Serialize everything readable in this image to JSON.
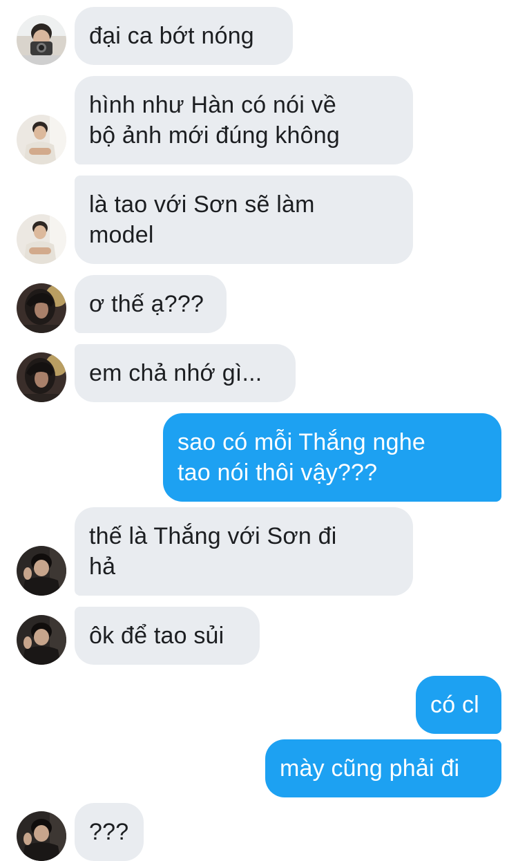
{
  "colors": {
    "incoming_bubble": "#e9ecf0",
    "outgoing_bubble": "#1da1f2",
    "incoming_text": "#1c1e21",
    "outgoing_text": "#ffffff"
  },
  "messages": [
    {
      "direction": "incoming",
      "sender_avatar": "avatar-camera-user",
      "lines": [
        "đại ca bớt nóng"
      ]
    },
    {
      "direction": "incoming",
      "sender_avatar": "avatar-arms-crossed-user",
      "lines": [
        "hình như Hàn có nói về",
        "bộ ảnh mới đúng không"
      ]
    },
    {
      "direction": "incoming",
      "sender_avatar": "avatar-arms-crossed-user",
      "lines": [
        "là tao với Sơn sẽ làm",
        "model"
      ]
    },
    {
      "direction": "incoming",
      "sender_avatar": "avatar-hooded-user",
      "lines": [
        "ơ thế ạ???"
      ]
    },
    {
      "direction": "incoming",
      "sender_avatar": "avatar-hooded-user",
      "lines": [
        "em chả nhớ gì..."
      ]
    },
    {
      "direction": "outgoing",
      "lines": [
        "sao có mỗi Thắng nghe",
        "tao nói thôi vậy???"
      ]
    },
    {
      "direction": "incoming",
      "sender_avatar": "avatar-dark-user",
      "lines": [
        "thế là Thắng với Sơn đi",
        "hả"
      ]
    },
    {
      "direction": "incoming",
      "sender_avatar": "avatar-dark-user",
      "lines": [
        "ôk để tao sủi"
      ]
    },
    {
      "direction": "outgoing",
      "lines": [
        "có cl"
      ]
    },
    {
      "direction": "outgoing",
      "lines": [
        "mày cũng phải đi"
      ]
    },
    {
      "direction": "incoming",
      "sender_avatar": "avatar-dark-user",
      "lines": [
        "???"
      ]
    }
  ]
}
